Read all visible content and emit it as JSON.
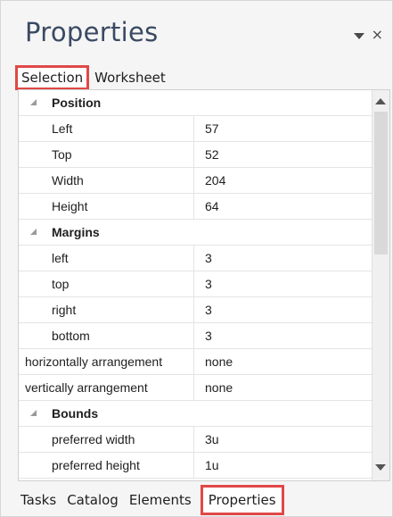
{
  "panel": {
    "title": "Properties"
  },
  "top_tabs": [
    {
      "label": "Selection",
      "active": true
    },
    {
      "label": "Worksheet",
      "active": false
    }
  ],
  "grid": {
    "position": {
      "category": "Position",
      "rows": [
        {
          "name": "Left",
          "value": "57"
        },
        {
          "name": "Top",
          "value": "52"
        },
        {
          "name": "Width",
          "value": "204"
        },
        {
          "name": "Height",
          "value": "64"
        }
      ]
    },
    "margins": {
      "category": "Margins",
      "rows": [
        {
          "name": "left",
          "value": "3"
        },
        {
          "name": "top",
          "value": "3"
        },
        {
          "name": "right",
          "value": "3"
        },
        {
          "name": "bottom",
          "value": "3"
        }
      ]
    },
    "arrangement": [
      {
        "name": "horizontally arrangement",
        "value": "none"
      },
      {
        "name": "vertically arrangement",
        "value": "none"
      }
    ],
    "bounds": {
      "category": "Bounds",
      "rows": [
        {
          "name": "preferred width",
          "value": "3u"
        },
        {
          "name": "preferred height",
          "value": "1u"
        }
      ]
    }
  },
  "bottom_tabs": [
    {
      "label": "Tasks",
      "active": false
    },
    {
      "label": "Catalog",
      "active": false
    },
    {
      "label": "Elements",
      "active": false
    },
    {
      "label": "Properties",
      "active": true
    }
  ],
  "colors": {
    "highlight": "#e14848",
    "title": "#3a4a63"
  }
}
